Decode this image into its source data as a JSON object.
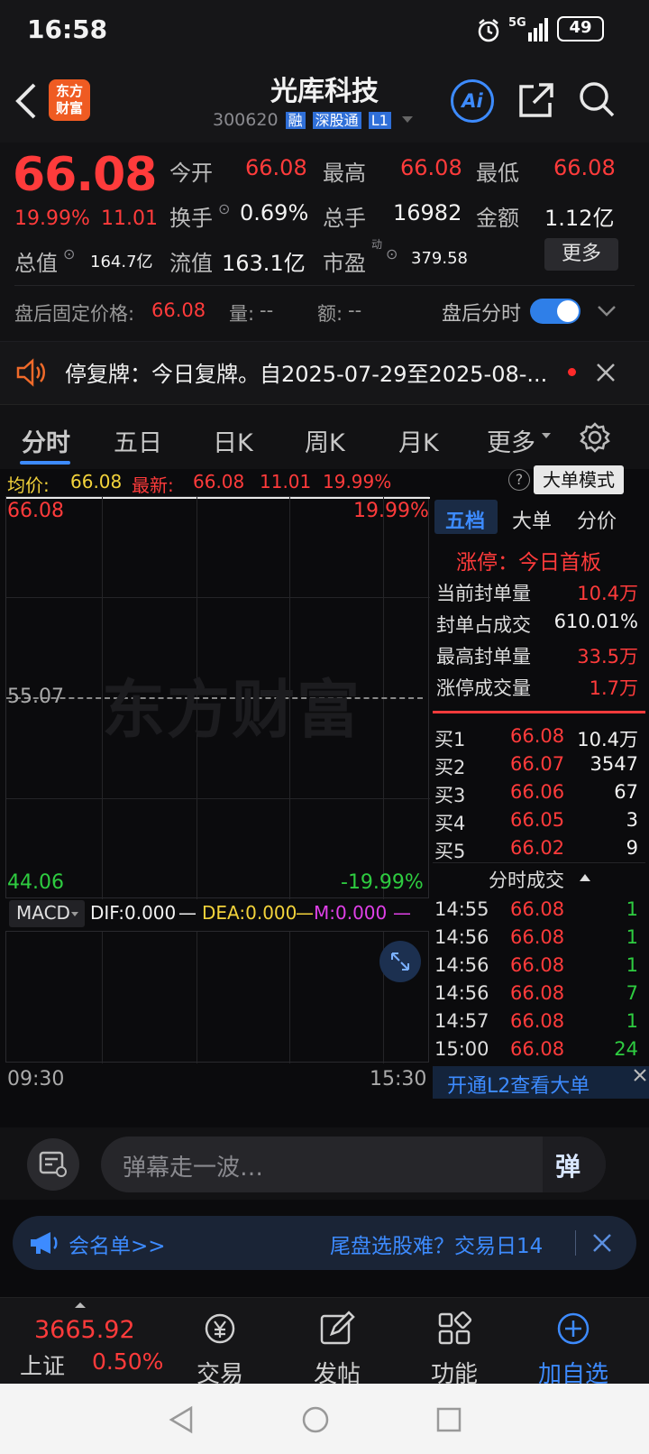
{
  "status": {
    "time": "16:58",
    "network": "5G",
    "battery": "49"
  },
  "header": {
    "logo": "东方\n财富",
    "logo_line1": "东方",
    "logo_line2": "财富",
    "name": "光库科技",
    "code": "300620",
    "tags": [
      "融",
      "深股通",
      "L1"
    ],
    "ai_label": "Ai"
  },
  "quote": {
    "price": "66.08",
    "change_pct": "19.99%",
    "change": "11.01",
    "open_label": "今开",
    "open": "66.08",
    "high_label": "最高",
    "high": "66.08",
    "low_label": "最低",
    "low": "66.08",
    "turnover_label": "换手",
    "turnover": "0.69%",
    "volume_label": "总手",
    "volume": "16982",
    "amount_label": "金额",
    "amount": "1.12亿",
    "mktcap_label": "总值",
    "mktcap": "164.7亿",
    "float_label": "流值",
    "float": "163.1亿",
    "pe_label": "市盈",
    "pe_sup": "动",
    "pe": "379.58",
    "more_button": "更多",
    "after_label": "盘后固定价格:",
    "after_price": "66.08",
    "after_vol_label": "量:",
    "after_vol": "--",
    "after_amt_label": "额:",
    "after_amt": "--",
    "after_timeshare_label": "盘后分时"
  },
  "notice": {
    "text": "停复牌：今日复牌。自2025-07-29至2025-08-..."
  },
  "tabs": [
    "分时",
    "五日",
    "日K",
    "周K",
    "月K",
    "更多"
  ],
  "chart_bar": {
    "avg_label": "均价:",
    "avg": "66.08",
    "latest_label": "最新:",
    "latest": "66.08",
    "chg": "11.01",
    "pct": "19.99%",
    "mode_button": "大单模式"
  },
  "chart": {
    "top_price": "66.08",
    "top_pct": "19.99%",
    "mid_price": "55.07",
    "bottom_price": "44.06",
    "bottom_pct": "-19.99%",
    "watermark": "东方财富",
    "time_start": "09:30",
    "time_end": "15:30"
  },
  "macd": {
    "selector": "MACD",
    "dif": "DIF:0.000",
    "dea": "DEA:0.000",
    "m": "M:0.000"
  },
  "right_panel": {
    "tabs": [
      "五档",
      "大单",
      "分价"
    ],
    "limit_status": "涨停：今日首板",
    "stats": [
      {
        "label": "当前封单量",
        "value": "10.4万"
      },
      {
        "label": "封单占成交",
        "value": "610.01%"
      },
      {
        "label": "最高封单量",
        "value": "33.5万"
      },
      {
        "label": "涨停成交量",
        "value": "1.7万"
      }
    ],
    "bids": [
      {
        "label": "买1",
        "price": "66.08",
        "vol": "10.4万"
      },
      {
        "label": "买2",
        "price": "66.07",
        "vol": "3547"
      },
      {
        "label": "买3",
        "price": "66.06",
        "vol": "67"
      },
      {
        "label": "买4",
        "price": "66.05",
        "vol": "3"
      },
      {
        "label": "买5",
        "price": "66.02",
        "vol": "9"
      }
    ],
    "ticks_title": "分时成交",
    "ticks": [
      {
        "time": "14:55",
        "price": "66.08",
        "vol": "1"
      },
      {
        "time": "14:56",
        "price": "66.08",
        "vol": "1"
      },
      {
        "time": "14:56",
        "price": "66.08",
        "vol": "1"
      },
      {
        "time": "14:56",
        "price": "66.08",
        "vol": "7"
      },
      {
        "time": "14:57",
        "price": "66.08",
        "vol": "1"
      },
      {
        "time": "15:00",
        "price": "66.08",
        "vol": "24"
      }
    ],
    "l2_banner": "开通L2查看大单"
  },
  "danmu": {
    "placeholder": "弹幕走一波…",
    "send": "弹"
  },
  "ticker": {
    "left": "会名单>>",
    "right": "尾盘选股难？交易日14"
  },
  "bottom": {
    "index_value": "3665.92",
    "index_name": "上证",
    "index_pct": "0.50%",
    "items": [
      "交易",
      "发帖",
      "功能",
      "加自选"
    ]
  }
}
